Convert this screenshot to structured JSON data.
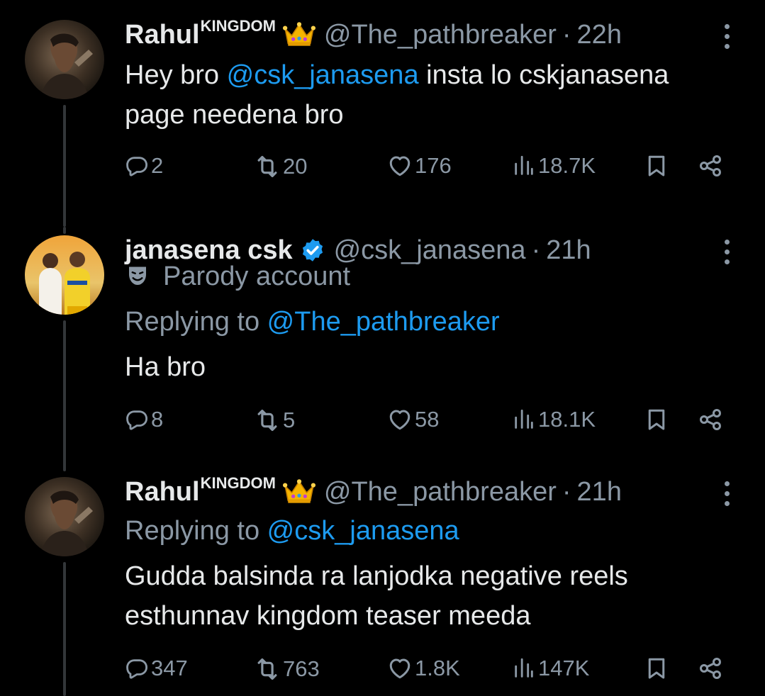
{
  "tweets": [
    {
      "name": "Rahul",
      "name_sup": "KINGDOM",
      "badge": "crown-emoji",
      "handle": "@The_pathbreaker",
      "separator": "·",
      "time": "22h",
      "body_prefix": "Hey bro ",
      "body_mention": "@csk_janasena",
      "body_suffix_1": " insta lo cskjanasena",
      "body_line2": "page needena bro",
      "replies": "2",
      "reposts": "20",
      "likes": "176",
      "views": "18.7K"
    },
    {
      "name": "janasena csk",
      "badge": "verified-badge",
      "handle": "@csk_janasena",
      "separator": "·",
      "time": "21h",
      "label_icon": "theater-masks",
      "label": "Parody account",
      "replying_prefix": "Replying to ",
      "replying_to": "@The_pathbreaker",
      "body": "Ha bro",
      "replies": "8",
      "reposts": "5",
      "likes": "58",
      "views": "18.1K"
    },
    {
      "name": "Rahul",
      "name_sup": "KINGDOM",
      "badge": "crown-emoji",
      "handle": "@The_pathbreaker",
      "separator": "·",
      "time": "21h",
      "replying_prefix": "Replying to ",
      "replying_to": "@csk_janasena",
      "body_line1": "Gudda balsinda ra lanjodka negative reels",
      "body_line2": "esthunnav kingdom teaser meeda",
      "replies": "347",
      "reposts": "763",
      "likes": "1.8K",
      "views": "147K"
    }
  ],
  "colors": {
    "background": "#000000",
    "text": "#e7e9ea",
    "muted": "#8b98a5",
    "link": "#1d9bf0",
    "verified": "#1d9bf0"
  }
}
